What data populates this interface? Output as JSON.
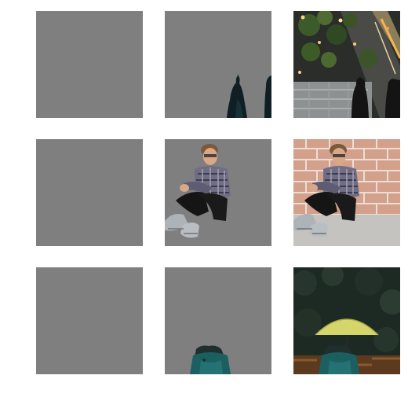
{
  "grid": {
    "rows": [
      {
        "name": "row-city",
        "tiles": [
          {
            "kind": "gray-blank"
          },
          {
            "kind": "masked-foreground",
            "subject": "people-silhouettes"
          },
          {
            "kind": "full-photo",
            "subject": "aerial-city-street"
          }
        ]
      },
      {
        "name": "row-man",
        "tiles": [
          {
            "kind": "gray-blank"
          },
          {
            "kind": "masked-foreground",
            "subject": "seated-man"
          },
          {
            "kind": "full-photo",
            "subject": "seated-man-brick-wall"
          }
        ]
      },
      {
        "name": "row-umbrella",
        "tiles": [
          {
            "kind": "gray-blank"
          },
          {
            "kind": "masked-foreground",
            "subject": "person-teal-coat"
          },
          {
            "kind": "full-photo",
            "subject": "person-yellow-umbrella-forest"
          }
        ]
      }
    ],
    "colors": {
      "background": "#7f7f7f",
      "page": "#ffffff"
    }
  }
}
